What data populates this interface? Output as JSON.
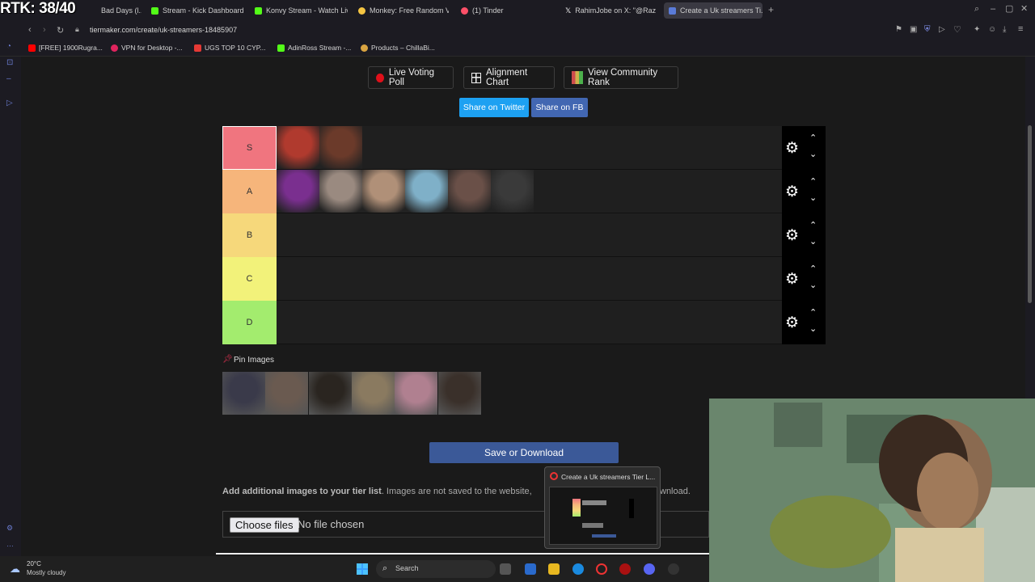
{
  "overlay": {
    "rtk_counter": "RTK: 38/40"
  },
  "browser": {
    "tabs": [
      {
        "label": "Bad Days (l...",
        "color": "#2a2a2a"
      },
      {
        "label": "Stream - Kick Dashboard",
        "color": "#53fc18"
      },
      {
        "label": "Konvy Stream - Watch Liv...",
        "color": "#53fc18"
      },
      {
        "label": "Monkey: Free Random Vi...",
        "color": "#f5c542"
      },
      {
        "label": "(1) Tinder",
        "color": "#fd5068"
      },
      {
        "label": "RahimJobe on X: \"@Razz...",
        "color": "#ffffff"
      },
      {
        "label": "Create a Uk streamers Ti...",
        "color": "#5a7bd8"
      }
    ],
    "url": "tiermaker.com/create/uk-streamers-18485907",
    "bookmarks": [
      {
        "label": "[FREE] 1900Rugra...",
        "color": "#ff0000"
      },
      {
        "label": "VPN for Desktop -...",
        "color": "#e0245e"
      },
      {
        "label": "UGS TOP 10 CYP...",
        "color": "#e53935"
      },
      {
        "label": "AdinRoss Stream -...",
        "color": "#53fc18"
      },
      {
        "label": "Products – ChillaBi...",
        "color": "#d9a441"
      }
    ]
  },
  "toolbar": {
    "live_voting_poll": "Live Voting Poll",
    "alignment_chart": "Alignment Chart",
    "view_community_rank": "View Community Rank",
    "share_twitter": "Share on Twitter",
    "share_fb": "Share on FB"
  },
  "tiers": [
    {
      "label": "S",
      "color": "#f0757f",
      "images": [
        "#b03a2e",
        "#6b3a2a"
      ]
    },
    {
      "label": "A",
      "color": "#f6b57b",
      "images": [
        "#7a2f8f",
        "#9a8a80",
        "#b09078",
        "#7fb0c8",
        "#6a5048",
        "#3a3a3a"
      ]
    },
    {
      "label": "B",
      "color": "#f6d87b",
      "images": []
    },
    {
      "label": "C",
      "color": "#f2f27a",
      "images": []
    },
    {
      "label": "D",
      "color": "#a3ec6e",
      "images": []
    }
  ],
  "pin": {
    "label": "Pin Images",
    "images": [
      "#3a3a4a",
      "#6a5a50",
      "#2a2520",
      "#8a7a60",
      "#b08090",
      "#3a302a"
    ]
  },
  "save_label": "Save or Download",
  "add_images": {
    "bold": "Add additional images to your tier list",
    "rest": ". Images are not saved to the website,",
    "tail": "wnload."
  },
  "file_input": {
    "button": "Choose files",
    "status": "No file chosen"
  },
  "thumbnail": {
    "title": "Create a Uk streamers Tier L..."
  },
  "taskbar": {
    "temperature": "20°C",
    "condition": "Mostly cloudy",
    "search_placeholder": "Search"
  }
}
